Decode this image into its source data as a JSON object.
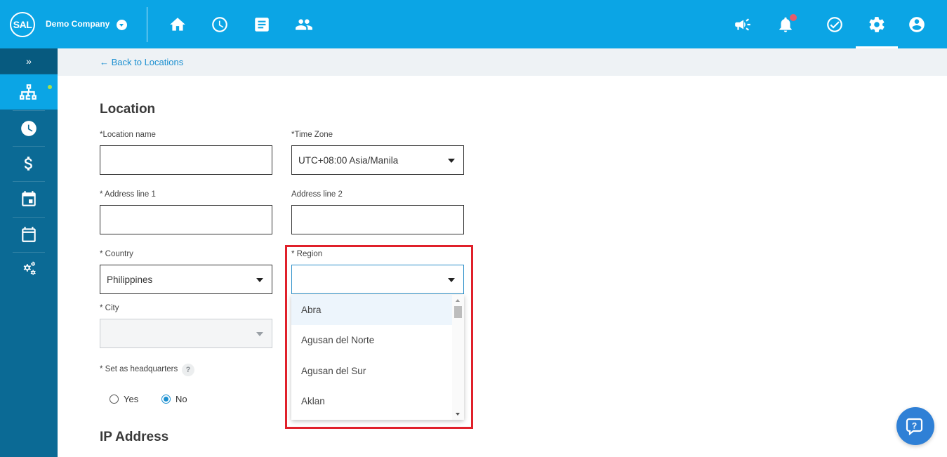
{
  "header": {
    "logo_text": "SAL",
    "company_name": "Demo Company",
    "nav_icons": [
      "home-icon",
      "clock-icon",
      "document-icon",
      "people-icon"
    ],
    "right_icons": [
      "megaphone-icon",
      "bell-icon",
      "check-circle-icon",
      "gear-icon",
      "user-icon"
    ],
    "notification_badge_color": "#e85b6b"
  },
  "sidebar": {
    "toggle_label": "»",
    "items": [
      "org-chart-icon",
      "clock-icon",
      "dollar-icon",
      "calendar-icon",
      "calendar-alt-icon",
      "settings-gears-icon"
    ],
    "active_index": 0
  },
  "breadcrumb": {
    "back_label": "← Back to Locations"
  },
  "form": {
    "section_title": "Location",
    "location_name_label": "*Location name",
    "location_name_value": "",
    "time_zone_label": "*Time Zone",
    "time_zone_value": "UTC+08:00 Asia/Manila",
    "address1_label": "* Address line 1",
    "address1_value": "",
    "address2_label": "Address line 2",
    "address2_value": "",
    "country_label": "* Country",
    "country_value": "Philippines",
    "region_label": "* Region",
    "region_value": "",
    "city_label": "* City",
    "city_value": "",
    "hq_label": "* Set as headquarters",
    "hq_help": "?",
    "hq_yes": "Yes",
    "hq_no": "No",
    "hq_selected": "No",
    "ip_section_title": "IP Address"
  },
  "region_dropdown": {
    "options": [
      "Abra",
      "Agusan del Norte",
      "Agusan del Sur",
      "Aklan"
    ],
    "highlighted": "Abra"
  },
  "colors": {
    "topbar": "#0ba5e5",
    "sidebar": "#0b6a95",
    "accent_link": "#1b8fd0",
    "highlight_border": "#e0202a"
  }
}
